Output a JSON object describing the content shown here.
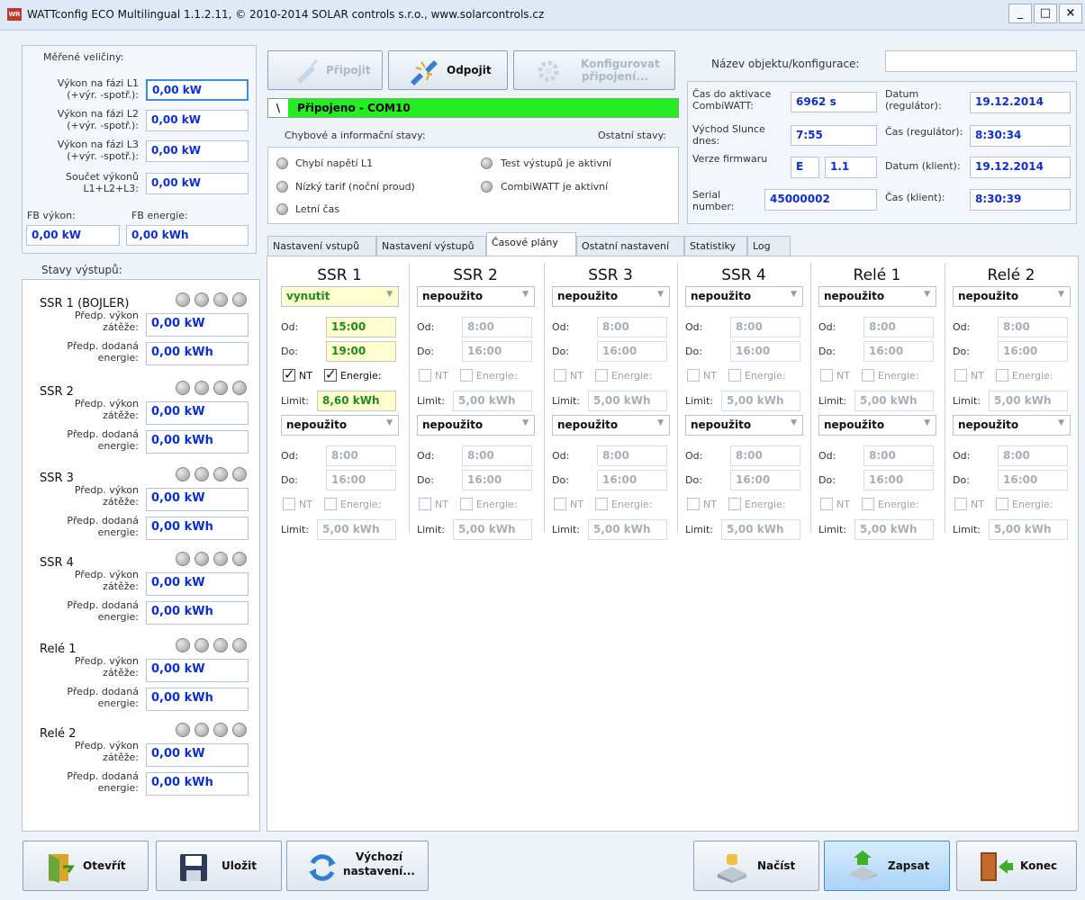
{
  "window": {
    "title": "WATTconfig ECO Multilingual 1.1.2.11, © 2010-2014 SOLAR controls s.r.o., www.solarcontrols.cz",
    "icon_text": "WR",
    "minimize": "_",
    "maximize": "□",
    "close": "×"
  },
  "measured": {
    "heading": "Měřené veličiny:",
    "rows": [
      {
        "label1": "Výkon na fázi L1",
        "label2": "(+výr. -spotř.):",
        "value": "0,00 kW"
      },
      {
        "label1": "Výkon na fázi L2",
        "label2": "(+výr. -spotř.):",
        "value": "0,00 kW"
      },
      {
        "label1": "Výkon na fázi L3",
        "label2": "(+výr. -spotř.):",
        "value": "0,00 kW"
      },
      {
        "label1": "Součet výkonů",
        "label2": "L1+L2+L3:",
        "value": "0,00 kW"
      }
    ],
    "fb_power_label": "FB výkon:",
    "fb_energy_label": "FB energie:",
    "fb_power_value": "0,00 kW",
    "fb_energy_value": "0,00 kWh"
  },
  "connection": {
    "connect_label": "Připojit",
    "disconnect_label": "Odpojit",
    "configure_label1": "Konfigurovat",
    "configure_label2": "připojení...",
    "status_spinner": "\\",
    "status_text": "Připojeno - COM10",
    "status_color": "#22ee22"
  },
  "states": {
    "errors_heading": "Chybové a informační stavy:",
    "other_heading": "Ostatní stavy:",
    "items": [
      "Chybí napětí L1",
      "Nízký tarif (noční proud)",
      "Letní čas",
      "Test výstupů je aktivní",
      "CombiWATT je aktivní"
    ]
  },
  "object": {
    "name_label": "Název objektu/konfigurace:",
    "name_value": "",
    "combiwatt_label1": "Čas do aktivace",
    "combiwatt_label2": "CombiWATT:",
    "combiwatt_value": "6962 s",
    "sunrise_label1": "Východ Slunce",
    "sunrise_label2": "dnes:",
    "sunrise_value": "7:55",
    "fw_label": "Verze firmwaru",
    "fw_value1": "E",
    "fw_value2": "1.1",
    "serial_label1": "Serial",
    "serial_label2": "number:",
    "serial_value": "45000002",
    "date_reg_label1": "Datum",
    "date_reg_label2": "(regulátor):",
    "date_reg_value": "19.12.2014",
    "time_reg_label": "Čas (regulátor):",
    "time_reg_value": "8:30:34",
    "date_client_label": "Datum (klient):",
    "date_client_value": "19.12.2014",
    "time_client_label": "Čas (klient):",
    "time_client_value": "8:30:39"
  },
  "outputs": {
    "heading": "Stavy výstupů:",
    "power_label1": "Předp. výkon",
    "power_label2": "zátěže:",
    "energy_label1": "Předp. dodaná",
    "energy_label2": "energie:",
    "items": [
      {
        "name": "SSR 1 (BOJLER)",
        "power": "0,00 kW",
        "energy": "0,00 kWh"
      },
      {
        "name": "SSR 2",
        "power": "0,00 kW",
        "energy": "0,00 kWh"
      },
      {
        "name": "SSR 3",
        "power": "0,00 kW",
        "energy": "0,00 kWh"
      },
      {
        "name": "SSR 4",
        "power": "0,00 kW",
        "energy": "0,00 kWh"
      },
      {
        "name": "Relé 1",
        "power": "0,00 kW",
        "energy": "0,00 kWh"
      },
      {
        "name": "Relé 2",
        "power": "0,00 kW",
        "energy": "0,00 kWh"
      }
    ]
  },
  "tabs": [
    "Nastavení vstupů",
    "Nastavení výstupů",
    "Časové plány",
    "Ostatní nastavení",
    "Statistiky",
    "Log"
  ],
  "active_tab": "Časové plány",
  "schedule": {
    "from_label": "Od:",
    "to_label": "Do:",
    "nt_label": "NT",
    "energy_label": "Energie:",
    "limit_label": "Limit:",
    "columns": [
      {
        "title": "SSR 1",
        "plans": [
          {
            "mode": "vynutit",
            "from": "15:00",
            "to": "19:00",
            "nt": true,
            "energy": true,
            "limit": "8,60 kWh",
            "active": true
          },
          {
            "mode": "nepoužito",
            "from": "8:00",
            "to": "16:00",
            "nt": false,
            "energy": false,
            "limit": "5,00 kWh",
            "active": false
          }
        ]
      },
      {
        "title": "SSR 2",
        "plans": [
          {
            "mode": "nepoužito",
            "from": "8:00",
            "to": "16:00",
            "nt": false,
            "energy": false,
            "limit": "5,00 kWh",
            "active": false
          },
          {
            "mode": "nepoužito",
            "from": "8:00",
            "to": "16:00",
            "nt": false,
            "energy": false,
            "limit": "5,00 kWh",
            "active": false
          }
        ]
      },
      {
        "title": "SSR 3",
        "plans": [
          {
            "mode": "nepoužito",
            "from": "8:00",
            "to": "16:00",
            "nt": false,
            "energy": false,
            "limit": "5,00 kWh",
            "active": false
          },
          {
            "mode": "nepoužito",
            "from": "8:00",
            "to": "16:00",
            "nt": false,
            "energy": false,
            "limit": "5,00 kWh",
            "active": false
          }
        ]
      },
      {
        "title": "SSR 4",
        "plans": [
          {
            "mode": "nepoužito",
            "from": "8:00",
            "to": "16:00",
            "nt": false,
            "energy": false,
            "limit": "5,00 kWh",
            "active": false
          },
          {
            "mode": "nepoužito",
            "from": "8:00",
            "to": "16:00",
            "nt": false,
            "energy": false,
            "limit": "5,00 kWh",
            "active": false
          }
        ]
      },
      {
        "title": "Relé 1",
        "plans": [
          {
            "mode": "nepoužito",
            "from": "8:00",
            "to": "16:00",
            "nt": false,
            "energy": false,
            "limit": "5,00 kWh",
            "active": false
          },
          {
            "mode": "nepoužito",
            "from": "8:00",
            "to": "16:00",
            "nt": false,
            "energy": false,
            "limit": "5,00 kWh",
            "active": false
          }
        ]
      },
      {
        "title": "Relé 2",
        "plans": [
          {
            "mode": "nepoužito",
            "from": "8:00",
            "to": "16:00",
            "nt": false,
            "energy": false,
            "limit": "5,00 kWh",
            "active": false
          },
          {
            "mode": "nepoužito",
            "from": "8:00",
            "to": "16:00",
            "nt": false,
            "energy": false,
            "limit": "5,00 kWh",
            "active": false
          }
        ]
      }
    ]
  },
  "footer": {
    "open_label": "Otevřít",
    "save_label": "Uložit",
    "defaults_label1": "Výchozí",
    "defaults_label2": "nastavení...",
    "load_label": "Načíst",
    "write_label": "Zapsat",
    "exit_label": "Konec"
  },
  "colors": {
    "value_blue": "#0b2fd6",
    "active_green": "#1d8c1d",
    "active_field_bg": "#fdfdd0",
    "write_button_bg": "#bfe0fb"
  }
}
